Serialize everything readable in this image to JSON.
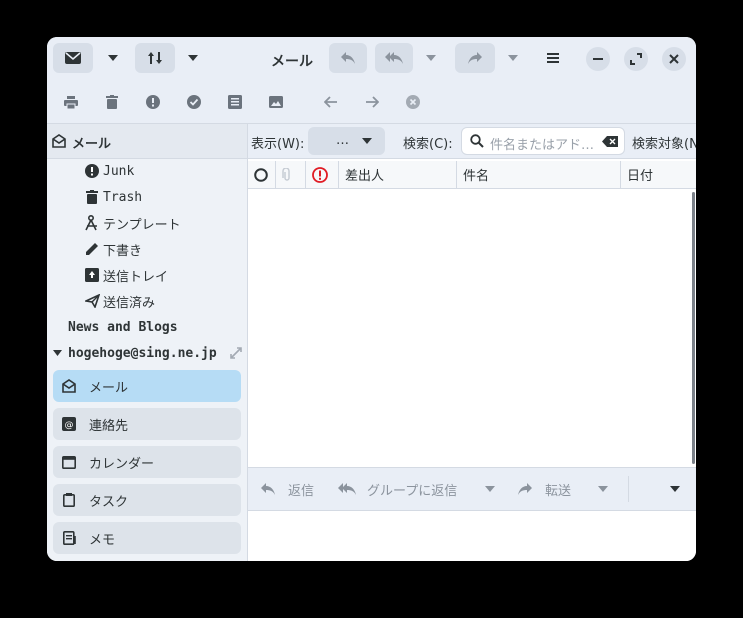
{
  "window": {
    "title": "メール"
  },
  "filter": {
    "view_label": "表示(W):",
    "view_value": "…",
    "search_label": "検索(C):",
    "search_placeholder": "件名またはアド…",
    "search_target_label": "検索対象(N"
  },
  "columns": {
    "sender": "差出人",
    "subject": "件名",
    "date": "日付"
  },
  "sidebar": {
    "header": "メール",
    "folders": [
      {
        "label": "Junk",
        "icon": "junk-icon",
        "mono": true
      },
      {
        "label": "Trash",
        "icon": "trash-icon",
        "mono": true
      },
      {
        "label": "テンプレート",
        "icon": "template-icon",
        "mono": false
      },
      {
        "label": "下書き",
        "icon": "pencil-icon",
        "mono": false
      },
      {
        "label": "送信トレイ",
        "icon": "outbox-icon",
        "mono": false
      },
      {
        "label": "送信済み",
        "icon": "sent-icon",
        "mono": false
      }
    ],
    "group": "News and Blogs",
    "account": "hogehoge@sing.ne.jp",
    "nav": [
      {
        "label": "メール",
        "icon": "mail-icon"
      },
      {
        "label": "連絡先",
        "icon": "contacts-icon"
      },
      {
        "label": "カレンダー",
        "icon": "calendar-icon"
      },
      {
        "label": "タスク",
        "icon": "tasks-icon"
      },
      {
        "label": "メモ",
        "icon": "memo-icon"
      }
    ]
  },
  "reply_bar": {
    "reply": "返信",
    "reply_group": "グループに返信",
    "forward": "転送"
  },
  "colors": {
    "accent": "#b6dcf5",
    "important": "#e01b24"
  }
}
